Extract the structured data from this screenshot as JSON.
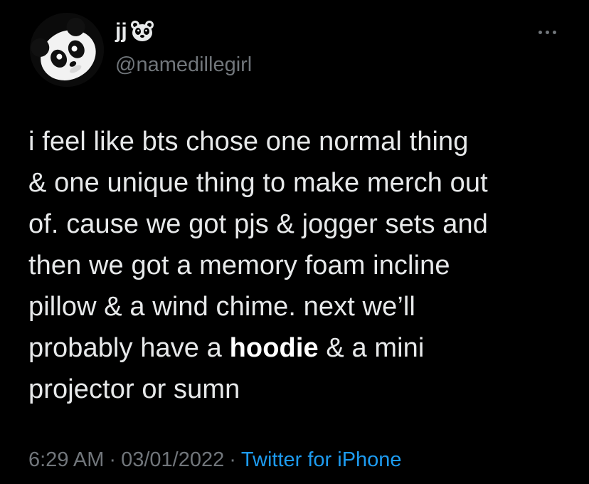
{
  "tweet": {
    "display_name": "jj",
    "name_emoji": "panda-face-icon",
    "handle": "@namedillegirl",
    "text_lines": [
      [
        "i feel like bts chose one normal thing"
      ],
      [
        "& one unique thing to make merch out"
      ],
      [
        "of. cause we got pjs & jogger sets and"
      ],
      [
        "then we got a memory foam incline"
      ],
      [
        "pillow & a wind chime. next we’ll"
      ],
      [
        "probably have a ",
        "hoodie",
        " & a mini"
      ],
      [
        "projector or sumn"
      ]
    ],
    "time": "6:29 AM",
    "date": "03/01/2022",
    "separator": "·",
    "source": "Twitter for iPhone"
  },
  "colors": {
    "background": "#000000",
    "text": "#e7e9ea",
    "muted": "#71767b",
    "link": "#1d9bf0"
  }
}
